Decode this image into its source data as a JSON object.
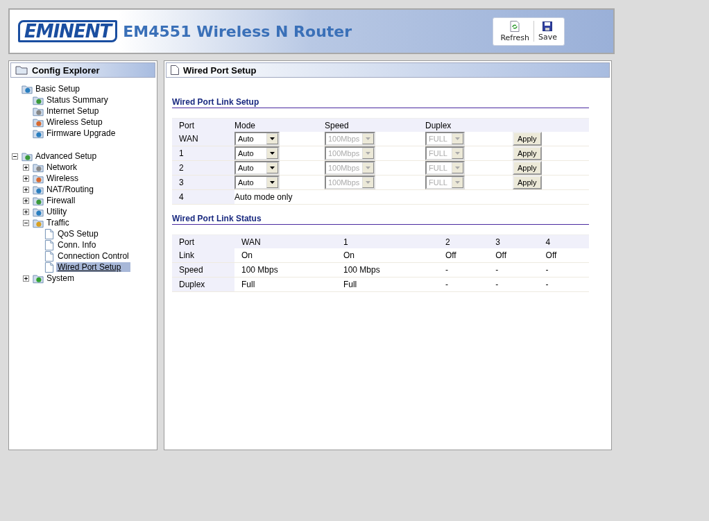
{
  "header": {
    "logo": "EMINENT",
    "title": "EM4551 Wireless N Router",
    "buttons": [
      {
        "kind": "refresh",
        "label": "Refresh"
      },
      {
        "kind": "save",
        "label": "Save"
      }
    ]
  },
  "sidebar": {
    "title": "Config Explorer",
    "tree": [
      {
        "label": "Basic Setup",
        "selected": false,
        "children": [
          {
            "label": "Status Summary",
            "selected": false
          },
          {
            "label": "Internet Setup",
            "selected": false
          },
          {
            "label": "Wireless Setup",
            "selected": false
          },
          {
            "label": "Firmware Upgrade",
            "selected": false
          }
        ]
      },
      {
        "label": "Advanced Setup",
        "expanded": true,
        "selected": false,
        "children": [
          {
            "label": "Network",
            "expanded": false,
            "selected": false
          },
          {
            "label": "Wireless",
            "expanded": false,
            "selected": false
          },
          {
            "label": "NAT/Routing",
            "expanded": false,
            "selected": false
          },
          {
            "label": "Firewall",
            "expanded": false,
            "selected": false
          },
          {
            "label": "Utility",
            "expanded": false,
            "selected": false
          },
          {
            "label": "Traffic",
            "expanded": true,
            "selected": false,
            "children": [
              {
                "label": "QoS Setup",
                "selected": false
              },
              {
                "label": "Conn. Info",
                "selected": false
              },
              {
                "label": "Connection Control",
                "selected": false
              },
              {
                "label": "Wired Port Setup",
                "selected": true
              }
            ]
          },
          {
            "label": "System",
            "expanded": false,
            "selected": false
          }
        ]
      }
    ]
  },
  "panel": {
    "title": "Wired Port Setup",
    "link_setup": {
      "title": "Wired Port Link Setup",
      "columns": [
        "Port",
        "Mode",
        "Speed",
        "Duplex"
      ],
      "rows": [
        {
          "port": "WAN",
          "kind": "select",
          "mode": {
            "value": "Auto",
            "disabled": false
          },
          "speed": {
            "value": "100Mbps",
            "disabled": true
          },
          "duplex": {
            "value": "FULL",
            "disabled": true
          },
          "button": "Apply"
        },
        {
          "port": "1",
          "kind": "select",
          "mode": {
            "value": "Auto",
            "disabled": false
          },
          "speed": {
            "value": "100Mbps",
            "disabled": true
          },
          "duplex": {
            "value": "FULL",
            "disabled": true
          },
          "button": "Apply"
        },
        {
          "port": "2",
          "kind": "select",
          "mode": {
            "value": "Auto",
            "disabled": false
          },
          "speed": {
            "value": "100Mbps",
            "disabled": true
          },
          "duplex": {
            "value": "FULL",
            "disabled": true
          },
          "button": "Apply"
        },
        {
          "port": "3",
          "kind": "select",
          "mode": {
            "value": "Auto",
            "disabled": false
          },
          "speed": {
            "value": "100Mbps",
            "disabled": true
          },
          "duplex": {
            "value": "FULL",
            "disabled": true
          },
          "button": "Apply"
        },
        {
          "port": "4",
          "kind": "note",
          "note": "Auto mode only"
        }
      ]
    },
    "link_status": {
      "title": "Wired Port Link Status",
      "columns": [
        "Port",
        "WAN",
        "1",
        "2",
        "3",
        "4"
      ],
      "rows": [
        {
          "cells": [
            "Link",
            "On",
            "On",
            "Off",
            "Off",
            "Off"
          ]
        },
        {
          "cells": [
            "Speed",
            "100 Mbps",
            "100 Mbps",
            "-",
            "-",
            "-"
          ]
        },
        {
          "cells": [
            "Duplex",
            "Full",
            "Full",
            "-",
            "-",
            "-"
          ]
        }
      ]
    }
  }
}
